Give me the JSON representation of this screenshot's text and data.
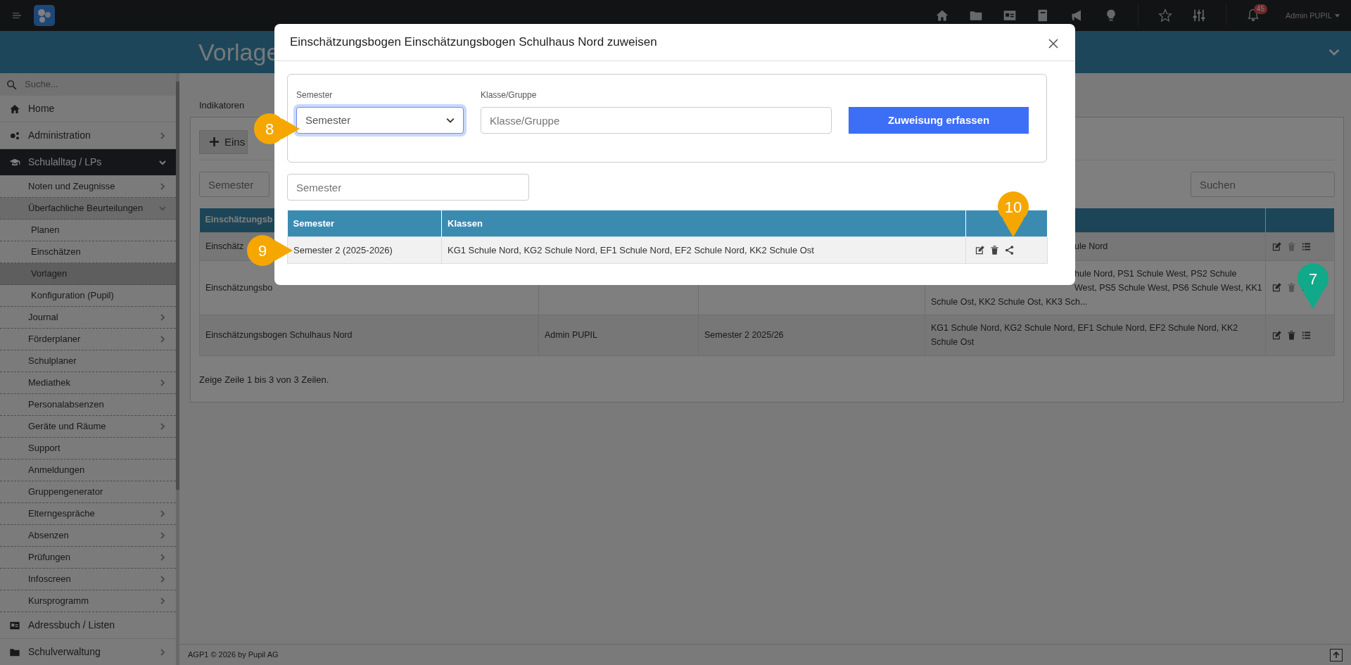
{
  "topbar": {
    "notification_count": "45",
    "user": "Admin PUPIL"
  },
  "page_title": "Vorlage",
  "sidebar": {
    "search_placeholder": "Suche...",
    "items": [
      {
        "label": "Home",
        "expandable": false,
        "expanded": false,
        "selected": false
      },
      {
        "label": "Administration",
        "expandable": true,
        "expanded": false,
        "selected": false
      },
      {
        "label": "Schulalltag / LPs",
        "expandable": true,
        "expanded": true,
        "selected": false,
        "children": [
          {
            "label": "Noten und Zeugnisse",
            "expandable": true,
            "expanded": false,
            "selected": false
          },
          {
            "label": "Überfachliche Beurteilungen",
            "expandable": true,
            "expanded": true,
            "selected": false,
            "children": [
              {
                "label": "Planen",
                "expandable": false,
                "expanded": false,
                "selected": false
              },
              {
                "label": "Einschätzen",
                "expandable": false,
                "expanded": false,
                "selected": false
              },
              {
                "label": "Vorlagen",
                "expandable": false,
                "expanded": false,
                "selected": true
              },
              {
                "label": "Konfiguration (Pupil)",
                "expandable": false,
                "expanded": false,
                "selected": false
              }
            ]
          },
          {
            "label": "Journal",
            "expandable": true,
            "expanded": false,
            "selected": false
          },
          {
            "label": "Förderplaner",
            "expandable": true,
            "expanded": false,
            "selected": false
          },
          {
            "label": "Schulplaner",
            "expandable": false,
            "expanded": false,
            "selected": false
          },
          {
            "label": "Mediathek",
            "expandable": true,
            "expanded": false,
            "selected": false
          },
          {
            "label": "Personalabsenzen",
            "expandable": false,
            "expanded": false,
            "selected": false
          },
          {
            "label": "Geräte und Räume",
            "expandable": true,
            "expanded": false,
            "selected": false
          },
          {
            "label": "Support",
            "expandable": false,
            "expanded": false,
            "selected": false
          },
          {
            "label": "Anmeldungen",
            "expandable": false,
            "expanded": false,
            "selected": false
          },
          {
            "label": "Gruppengenerator",
            "expandable": false,
            "expanded": false,
            "selected": false
          },
          {
            "label": "Elterngespräche",
            "expandable": true,
            "expanded": false,
            "selected": false
          },
          {
            "label": "Absenzen",
            "expandable": true,
            "expanded": false,
            "selected": false
          },
          {
            "label": "Prüfungen",
            "expandable": true,
            "expanded": false,
            "selected": false
          },
          {
            "label": "Infoscreen",
            "expandable": true,
            "expanded": false,
            "selected": false
          },
          {
            "label": "Kursprogramm",
            "expandable": true,
            "expanded": false,
            "selected": false
          }
        ]
      },
      {
        "label": "Adressbuch / Listen",
        "expandable": false,
        "expanded": false,
        "selected": false
      },
      {
        "label": "Schulverwaltung",
        "expandable": true,
        "expanded": false,
        "selected": false
      }
    ]
  },
  "tabs": [
    {
      "label": "Indikatoren",
      "selected": false
    }
  ],
  "add_button": "Eins",
  "filters": {
    "semester_placeholder": "Semester",
    "search_placeholder": "Suchen"
  },
  "table": {
    "columns": [
      "Einschätzungsb"
    ],
    "rows": [
      {
        "name": "Einschätz",
        "klassen_peek": [
          "ule Nord"
        ],
        "delete_disabled": true
      },
      {
        "name": "Einschätzungsbo",
        "klassen_peek": [
          "hule Nord, PS1 Schule West, PS2 Schule",
          "West, PS5 Schule West, PS6 Schule West, KK1"
        ],
        "klassen": "Schule Ost, KK2 Schule Ost, KK3 Sch...",
        "delete_disabled": true
      },
      {
        "name": "Einschätzungsbogen Schulhaus Nord",
        "author": "Admin PUPIL",
        "semester": "Semester 2 2025/26",
        "klassen": "KG1 Schule Nord, KG2 Schule Nord, EF1 Schule Nord, EF2 Schule Nord, KK2 Schule Ost",
        "delete_disabled": false
      }
    ]
  },
  "table_info": "Zeige Zeile 1 bis 3 von 3 Zeilen.",
  "footer": "AGP1 © 2026 by Pupil AG",
  "modal": {
    "title": "Einschätzungsbogen Einschätzungsbogen Schulhaus Nord zuweisen",
    "form": {
      "semester_label": "Semester",
      "semester_value": "Semester",
      "semester_focused": true,
      "class_label": "Klasse/Gruppe",
      "class_placeholder": "Klasse/Gruppe",
      "submit": "Zuweisung erfassen"
    },
    "filter_placeholder": "Semester",
    "table": {
      "columns": [
        "Semester",
        "Klassen"
      ],
      "rows": [
        {
          "semester": "Semester 2 (2025-2026)",
          "klassen": "KG1 Schule Nord, KG2 Schule Nord, EF1 Schule Nord, EF2 Schule Nord, KK2 Schule Ost"
        }
      ]
    }
  },
  "markers": [
    {
      "label": "8",
      "color": "#f5a700",
      "kind": "right"
    },
    {
      "label": "9",
      "color": "#f5a700",
      "kind": "right"
    },
    {
      "label": "10",
      "color": "#f5a700",
      "kind": "down"
    },
    {
      "label": "7",
      "color": "#10a98a",
      "kind": "down"
    }
  ]
}
